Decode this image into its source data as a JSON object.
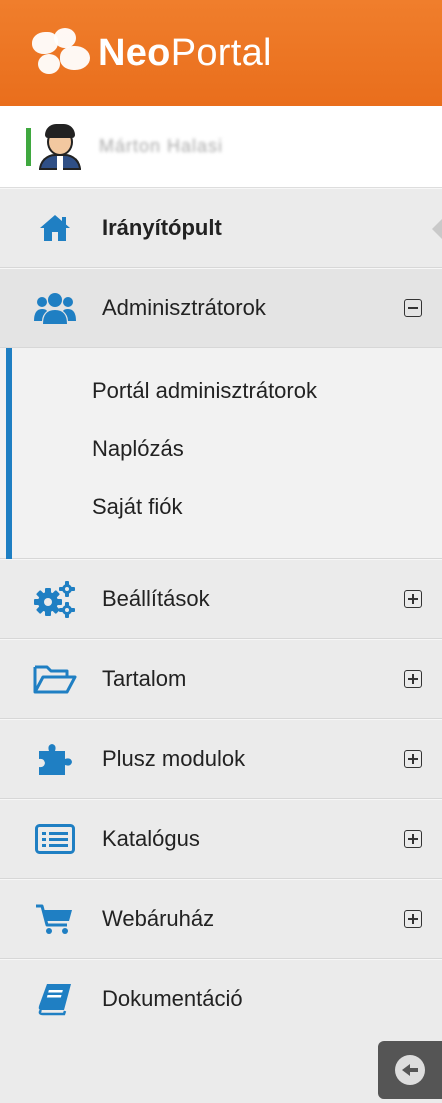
{
  "brand": {
    "name_bold": "Neo",
    "name_light": "Portal"
  },
  "user": {
    "name": "Márton Halasi"
  },
  "colors": {
    "accent": "#1f7fc3",
    "brand": "#ef7a2a",
    "status": "#3fa83f"
  },
  "menu": {
    "dashboard": {
      "label": "Irányítópult",
      "icon": "home-icon"
    },
    "admins": {
      "label": "Adminisztrátorok",
      "icon": "users-icon",
      "expanded": true,
      "submenu": [
        "Portál adminisztrátorok",
        "Naplózás",
        "Saját fiók"
      ]
    },
    "settings": {
      "label": "Beállítások",
      "icon": "gears-icon"
    },
    "content": {
      "label": "Tartalom",
      "icon": "folder-open-icon"
    },
    "modules": {
      "label": "Plusz modulok",
      "icon": "puzzle-icon"
    },
    "catalog": {
      "label": "Katalógus",
      "icon": "list-alt-icon"
    },
    "shop": {
      "label": "Webáruház",
      "icon": "cart-icon"
    },
    "docs": {
      "label": "Dokumentáció",
      "icon": "book-icon"
    }
  }
}
